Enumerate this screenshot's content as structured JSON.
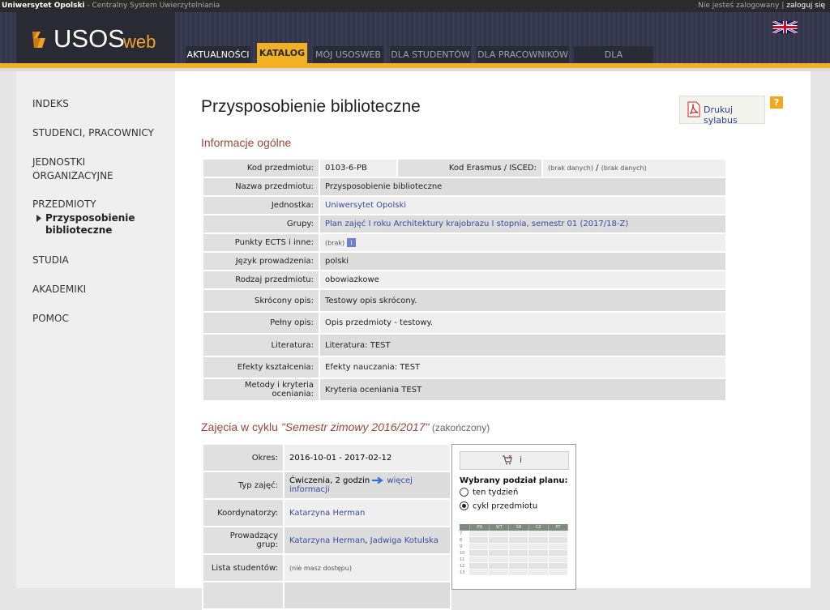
{
  "topbar": {
    "university": "Uniwersytet Opolski",
    "separator": " - ",
    "system": "Centralny System Uwierzytelniania",
    "not_logged": "Nie jesteś zalogowany",
    "divider": " | ",
    "login": "zaloguj się"
  },
  "logo": {
    "main": "USOS",
    "suffix": "web"
  },
  "nav": [
    "AKTUALNOŚCI",
    "KATALOG",
    "MÓJ USOSWEB",
    "DLA STUDENTÓW",
    "DLA PRACOWNIKÓW",
    "DLA WSZYSTKICH"
  ],
  "sidebar": {
    "indeks": "INDEKS",
    "studenci": "STUDENCI, PRACOWNICY",
    "jednostki1": "JEDNOSTKI",
    "jednostki2": "ORGANIZACYJNE",
    "przedmioty": "PRZEDMIOTY",
    "sub1": "Przysposobienie",
    "sub2": "biblioteczne",
    "studia": "STUDIA",
    "akademiki": "AKADEMIKI",
    "pomoc": "POMOC"
  },
  "page": {
    "title": "Przysposobienie biblioteczne",
    "print": "Drukuj sylabus",
    "help": "?",
    "section1": "Informacje ogólne",
    "section2_prefix": "Zajęcia w cyklu ",
    "section2_cycle": "\"Semestr zimowy 2016/2017\"",
    "section2_suffix": " (zakończony)"
  },
  "info": {
    "kod_label": "Kod przedmiotu:",
    "kod": "0103-6-PB",
    "erasmus_label": "Kod Erasmus / ISCED:",
    "erasmus_a": "(brak danych)",
    "erasmus_sep": " / ",
    "erasmus_b": "(brak danych)",
    "nazwa_label": "Nazwa przedmiotu:",
    "nazwa": "Przysposobienie biblioteczne",
    "jednostka_label": "Jednostka:",
    "jednostka": "Uniwersytet Opolski",
    "grupy_label": "Grupy:",
    "grupy": "Plan zajęć I roku Architektury krajobrazu I stopnia, semestr 01 (2017/18-Z)",
    "ects_label": "Punkty ECTS i inne:",
    "ects": "(brak)",
    "ects_icon": "i",
    "jezyk_label": "Język prowadzenia:",
    "jezyk": "polski",
    "rodzaj_label": "Rodzaj przedmiotu:",
    "rodzaj": "obowiazkowe",
    "skrocony_label": "Skrócony opis:",
    "skrocony": "Testowy opis skrócony.",
    "pelny_label": "Pełny opis:",
    "pelny": "Opis przedmioty - testowy.",
    "literatura_label": "Literatura:",
    "literatura": "Literatura: TEST",
    "efekty_label": "Efekty kształcenia:",
    "efekty": "Efekty nauczania: TEST",
    "metody_label": "Metody i kryteria oceniania:",
    "metody": "Kryteria oceniania TEST"
  },
  "cycle": {
    "okres_label": "Okres:",
    "okres": "2016-10-01 - 2017-02-12",
    "typ_label": "Typ zajęć:",
    "typ": "Ćwiczenia, 2 godzin",
    "more": "więcej informacji",
    "koord_label": "Koordynatorzy:",
    "koord": "Katarzyna Herman",
    "prow_label": "Prowadzący grup:",
    "prow1": "Katarzyna Herman",
    "prow_sep": ", ",
    "prow2": "Jadwiga Kotulska",
    "lista_label": "Lista studentów:",
    "lista": "(nie masz dostępu)"
  },
  "plan": {
    "info_glyph": "i",
    "title": "Wybrany podział planu:",
    "opt1": "ten tydzień",
    "opt2": "cykl przedmiotu",
    "selected": "cykl przedmiotu",
    "days": [
      "PN",
      "WT",
      "ŚR",
      "CZ",
      "PT"
    ],
    "hours": [
      "7",
      "8",
      "9",
      "10",
      "11",
      "12",
      "13"
    ]
  },
  "colors": {
    "accent": "#f1b123",
    "section": "#9c4638",
    "link": "#3a4aa0"
  }
}
